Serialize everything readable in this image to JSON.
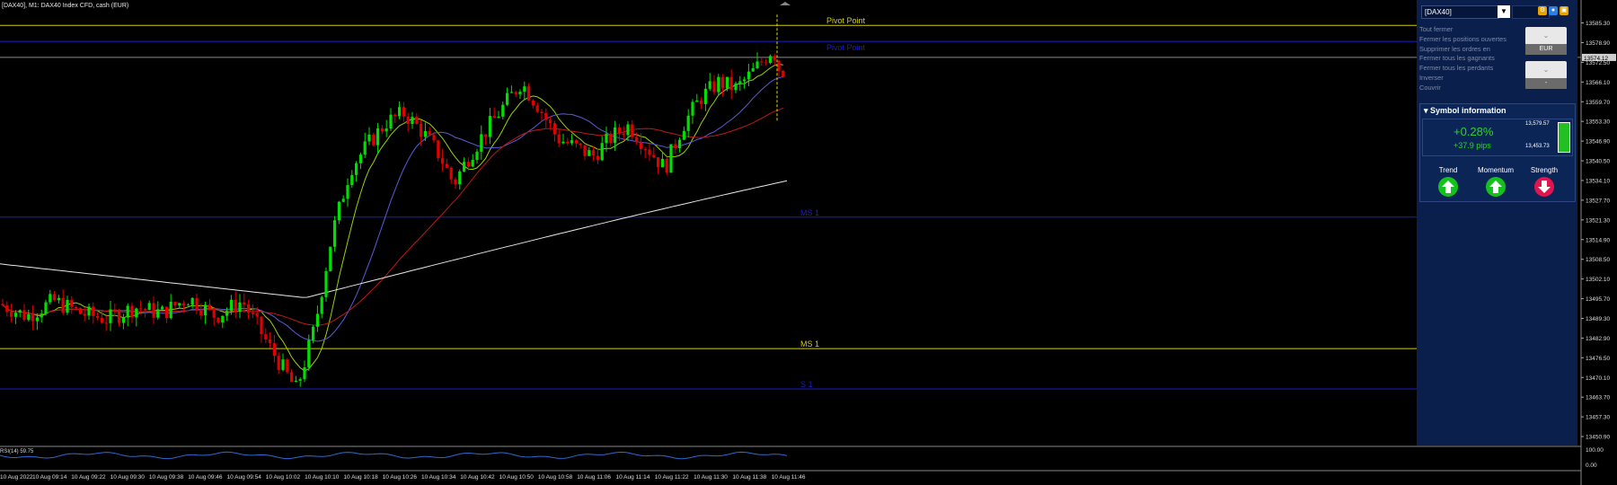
{
  "header": {
    "title": "[DAX40], M1: DAX40 Index CFD, cash (EUR)"
  },
  "levels": [
    {
      "label": "Pivot Point",
      "price": 13584.5,
      "color": "#d4d000"
    },
    {
      "label": "Pivot Point",
      "price": 13579.3,
      "color": "#1d1dcc"
    },
    {
      "label": "MS 1",
      "price": 13522.2,
      "color": "#1d1dcc"
    },
    {
      "label": "MS 1",
      "price": 13479.5,
      "color": "#d4d000"
    },
    {
      "label": "S 1",
      "price": 13466.4,
      "color": "#1d1dcc"
    }
  ],
  "current_price": {
    "label": "13574.12",
    "price": 13574.1
  },
  "price_axis": {
    "min": 13448,
    "max": 13591,
    "ticks": [
      "13585.30",
      "13578.90",
      "13572.50",
      "13566.10",
      "13559.70",
      "13553.30",
      "13546.90",
      "13540.50",
      "13534.10",
      "13527.70",
      "13521.30",
      "13514.90",
      "13508.50",
      "13502.10",
      "13495.70",
      "13489.30",
      "13482.90",
      "13476.50",
      "13470.10",
      "13463.70",
      "13457.30",
      "13450.90"
    ]
  },
  "oscillator": {
    "label": "RSI(14) 59.75",
    "axis_label": "0.00",
    "max_label": "100.00"
  },
  "time_axis": [
    "10 Aug 2022",
    "10 Aug 09:14",
    "10 Aug 09:22",
    "10 Aug 09:30",
    "10 Aug 09:38",
    "10 Aug 09:46",
    "10 Aug 09:54",
    "10 Aug 10:02",
    "10 Aug 10:10",
    "10 Aug 10:18",
    "10 Aug 10:26",
    "10 Aug 10:34",
    "10 Aug 10:42",
    "10 Aug 10:50",
    "10 Aug 10:58",
    "10 Aug 11:06",
    "10 Aug 11:14",
    "10 Aug 11:22",
    "10 Aug 11:30",
    "10 Aug 11:38",
    "10 Aug 11:46"
  ],
  "colors": {
    "bull": "#00e000",
    "bear": "#e00000",
    "ma_fast": "#9cd200",
    "ma_mid": "#5b5bd6",
    "ma_slow": "#c01818",
    "ma_long": "#e8e8e8",
    "rsi": "#2f6ad0"
  },
  "panel": {
    "symbol": "[DAX40]",
    "menu": [
      "Tout fermer",
      "Fermer les positions ouvertes",
      "Supprimer les ordres en",
      "Fermer tous les gagnants",
      "Fermer tous les perdants",
      "Inverser",
      "Couvrir"
    ],
    "currency_button": "EUR",
    "second_button": "-",
    "info_title": "Symbol information",
    "change_pct": "+0.28%",
    "change_pips": "+37.9 pips",
    "high": "13,579.57",
    "low": "13,453.73",
    "indicators": [
      {
        "label": "Trend",
        "direction": "up",
        "icon": "arrow-up-icon"
      },
      {
        "label": "Momentum",
        "direction": "up",
        "icon": "arrow-up-icon"
      },
      {
        "label": "Strength",
        "direction": "down",
        "icon": "arrow-down-icon"
      }
    ]
  }
}
